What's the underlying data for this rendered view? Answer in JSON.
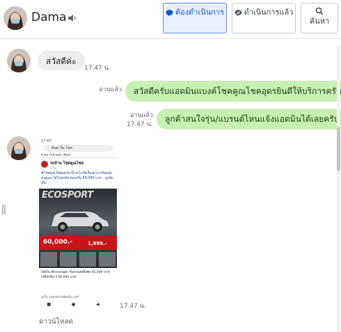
{
  "header": {
    "contact_name": "Dama",
    "buttons": {
      "in_progress": "ต้องดำเนินการ",
      "done": "ดำเนินการแล้ว",
      "search": "ค้นหา"
    }
  },
  "messages": [
    {
      "direction": "incoming",
      "text": "สวัสดีค่ะ",
      "time": "17.47 น."
    },
    {
      "direction": "outgoing",
      "text": "สวัสดีครับแอดมินแบงค์โชคคูณโชคอุดรยินดีให้บริการครับ",
      "read": "อ่านแล้ว"
    },
    {
      "direction": "outgoing",
      "text": "ลูกค้าสนใจรุ่น/แบรนด์ไหนแจ้งแอดมินได้เลยครับ",
      "read": "อ่านแล้ว",
      "time": "17.47 น."
    },
    {
      "direction": "incoming",
      "type": "image",
      "time": "17.47 น."
    }
  ],
  "screenshot_image": {
    "status": "17:47",
    "search_text": "ค้นหาใน โชค",
    "tabs": "รายการ   ตามหา   ค้นหา",
    "page_name": "รถบ้าน โชคคูณโชค",
    "page_date": "3 วัน",
    "post_text": "#โชคคูณโชคอุดรธานี รถไม่ใช่เรื่องยาก พร้อมส่งคนดูแล ใส่ใจทุกคัน ผ่อนเริ่ม 60,000 บาท ...ดูเพิ่มเติม",
    "model": "ECOSPORT",
    "down_payment": "60,000.-",
    "installment": "1,999.-",
    "post_text2": "เปิดใน Messenger รับส่วนลดพิเศษ 60,000 บาท เหลือเพียง 159,000 บาท",
    "actions": "ถูกใจ  แสดงความคิดเห็น  แชร์",
    "nav": "■ ● ◀"
  },
  "download_label": "ดาวน์โหลด",
  "colors": {
    "outgoing_bubble": "#c8f0b3",
    "incoming_bubble": "#eeeeee",
    "active_button": "#e8f0fe",
    "active_accent": "#1a56c4"
  },
  "icons": {
    "speaker": "speaker-icon",
    "chat_bubble": "chat-bubble-icon",
    "chat_check": "chat-check-icon",
    "search": "search-icon"
  }
}
